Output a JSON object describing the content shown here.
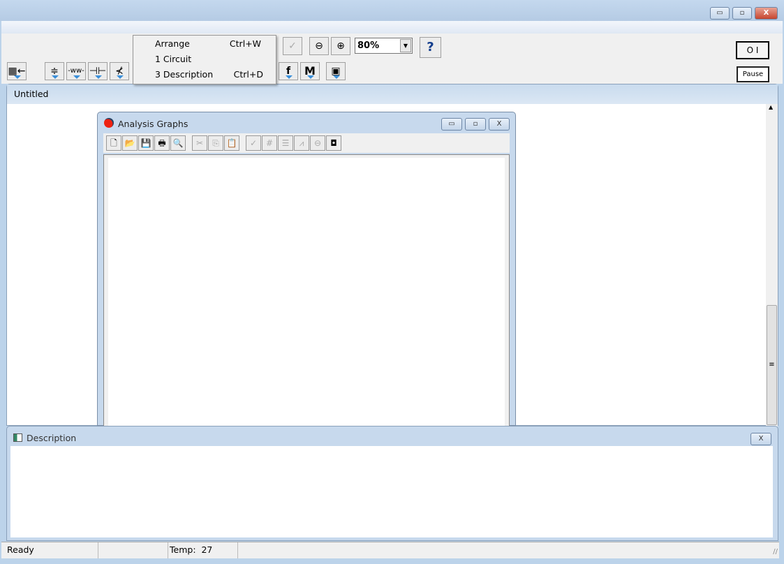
{
  "window": {
    "minimize": "▭",
    "maximize": "▫",
    "close": "X"
  },
  "menu_popup": {
    "items": [
      {
        "label": "Arrange",
        "shortcut": "Ctrl+W"
      },
      {
        "label": "1 Circuit",
        "shortcut": ""
      },
      {
        "label": "3 Description",
        "shortcut": "Ctrl+D"
      }
    ]
  },
  "toolbar": {
    "zoom_value": "80%",
    "help": "?",
    "pause": "Pause",
    "power": "O I",
    "function_label": "f",
    "meter_label": "M"
  },
  "document": {
    "title": "Untitled"
  },
  "analysis_graphs": {
    "title": "Analysis Graphs"
  },
  "description": {
    "title": "Description",
    "close": "X"
  },
  "status": {
    "ready": "Ready",
    "temp_label": "Temp:",
    "temp_value": "27"
  }
}
